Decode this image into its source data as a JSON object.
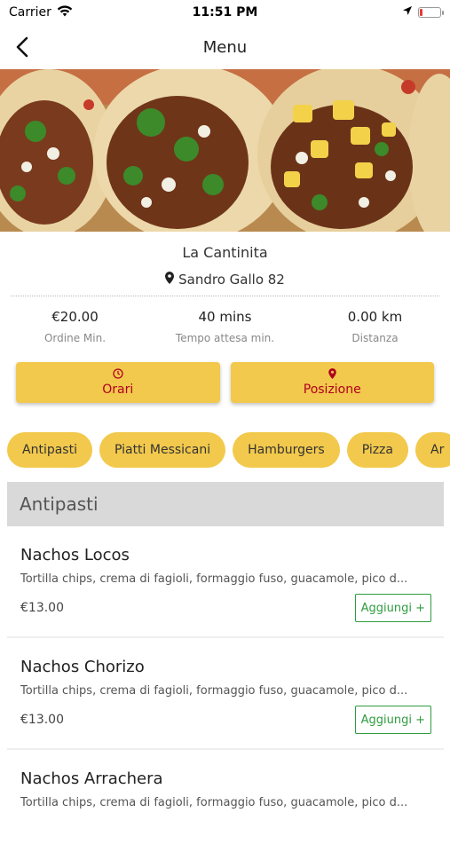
{
  "status_bar": {
    "carrier": "Carrier",
    "time": "11:51 PM"
  },
  "nav": {
    "title": "Menu"
  },
  "restaurant": {
    "name": "La Cantinita",
    "address": "Sandro Gallo 82"
  },
  "stats": [
    {
      "value": "€20.00",
      "label": "Ordine Min."
    },
    {
      "value": "40 mins",
      "label": "Tempo attesa min."
    },
    {
      "value": "0.00 km",
      "label": "Distanza"
    }
  ],
  "actions": {
    "hours_label": "Orari",
    "position_label": "Posizione"
  },
  "categories": [
    "Antipasti",
    "Piatti Messicani",
    "Hamburgers",
    "Pizza",
    "Ar"
  ],
  "menu": {
    "section_title": "Antipasti",
    "items": [
      {
        "name": "Nachos Locos",
        "description": "Tortilla chips, crema di fagioli, formaggio fuso, guacamole, pico d...",
        "price": "€13.00",
        "add_label": "Aggiungi +"
      },
      {
        "name": "Nachos Chorizo",
        "description": "Tortilla chips, crema di fagioli, formaggio fuso, guacamole, pico d...",
        "price": "€13.00",
        "add_label": "Aggiungi +"
      },
      {
        "name": "Nachos Arrachera",
        "description": "Tortilla chips, crema di fagioli, formaggio fuso, guacamole, pico d...",
        "price": "",
        "add_label": ""
      }
    ]
  },
  "colors": {
    "accent_yellow": "#f2c94c",
    "action_text_red": "#b00020",
    "add_green": "#2e9c3f"
  }
}
